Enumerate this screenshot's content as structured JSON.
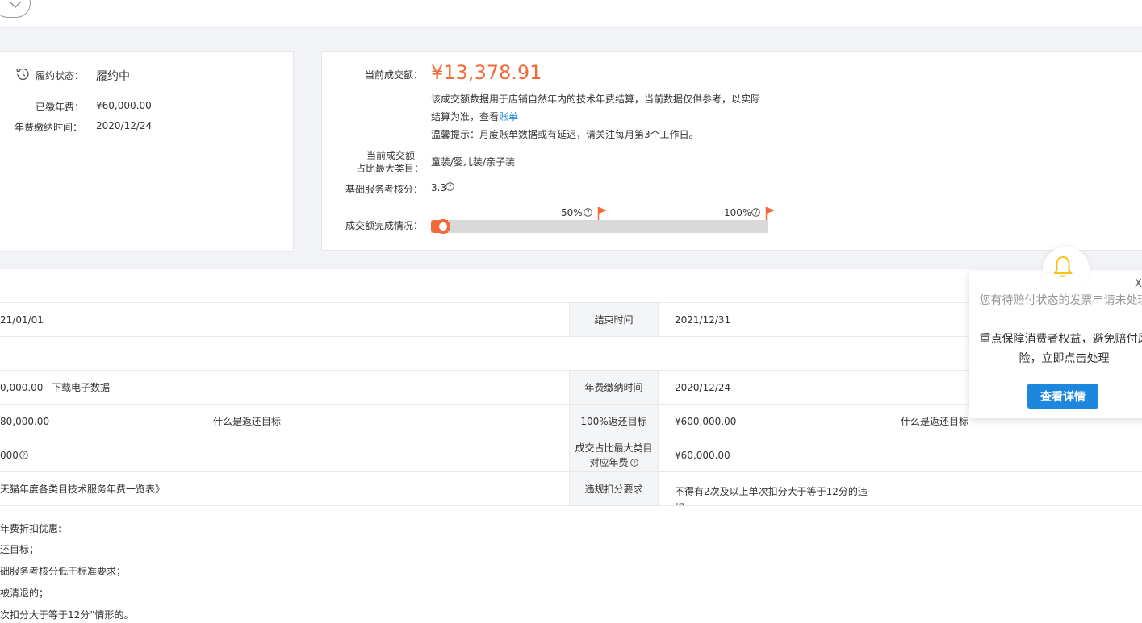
{
  "left_card": {
    "status_label": "履约状态：",
    "status_value": "履约中",
    "paid_fee_label": "已缴年费：",
    "paid_fee_value": "¥60,000.00",
    "pay_time_label": "年费缴纳时间：",
    "pay_time_value": "2020/12/24"
  },
  "right_card": {
    "turnover_label": "当前成交额：",
    "turnover_value": "¥13,378.91",
    "desc_line1": "该成交额数据用于店铺自然年内的技术年费结算，当前数据仅供参考，以实际",
    "desc_line2_prefix": "结算为准，查看",
    "bill_link": "账单",
    "tip": "温馨提示：月度账单数据或有延迟，请关注每月第3个工作日。",
    "max_category_label_line1": "当前成交额",
    "max_category_label_line2": "占比最大类目：",
    "max_category_value": "童装/婴儿装/亲子装",
    "score_label": "基础服务考核分：",
    "score_value": "3.3",
    "progress_label": "成交额完成情况：",
    "milestone_50": "50%",
    "milestone_100": "100%",
    "progress_fraction": 0.03
  },
  "table": {
    "row1": {
      "left_value": "21/01/01",
      "head": "结束时间",
      "right_value": "2021/12/31"
    },
    "row3": {
      "left_value": "0,000.00",
      "left_link": "下载电子数据",
      "head": "年费缴纳时间",
      "right_value": "2020/12/24"
    },
    "row4": {
      "left_value": "80,000.00",
      "left_link": "什么是返还目标",
      "head": "100%返还目标",
      "right_value": "¥600,000.00",
      "right_link": "什么是返还目标"
    },
    "row5": {
      "left_value": "000",
      "head_line1": "成交占比最大类目",
      "head_line2": "对应年费",
      "right_value": "¥60,000.00"
    },
    "row6": {
      "left_link": "天猫年度各类目技术服务年费一览表》",
      "head": "违规扣分要求",
      "right_value_line1": "不得有2次及以上单次扣分大于等于12分的违",
      "right_value_line2": "规"
    }
  },
  "bottom_notes": [
    "年费折扣优惠:",
    "还目标；",
    "础服务考核分低于标准要求；",
    "被清退的；",
    "次扣分大于等于12分”情形的。"
  ],
  "popup": {
    "line1": "您有待赔付状态的发票申请未处理",
    "line2": "重点保障消费者权益，避免赔付风险，立即点击处理",
    "button": "查看详情",
    "close": "X"
  },
  "colors": {
    "accent": "#f26a3a",
    "link": "#1d87dd",
    "bell": "#f5c518"
  }
}
